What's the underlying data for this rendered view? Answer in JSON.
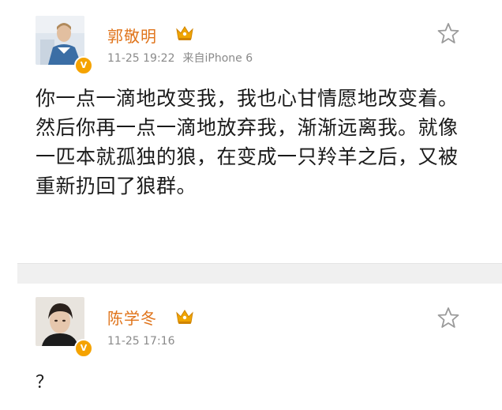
{
  "posts": [
    {
      "username": "郭敬明",
      "time": "11-25 19:22",
      "source": "来自iPhone 6",
      "content": "你一点一滴地改变我，我也心甘情愿地改变着。然后你再一点一滴地放弃我，渐渐远离我。就像一匹本就孤独的狼，在变成一只羚羊之后，又被重新扔回了狼群。",
      "verified_icon": "verified-badge-icon",
      "vip_icon": "vip-crown-icon",
      "favorite_icon": "star-icon"
    },
    {
      "username": "陈学冬",
      "time": "11-25 17:16",
      "content": "？",
      "verified_icon": "verified-badge-icon",
      "vip_icon": "vip-crown-icon",
      "favorite_icon": "star-icon"
    }
  ],
  "colors": {
    "username": "#e0741b",
    "meta": "#8a8a8a",
    "verified": "#f5a300",
    "crown": "#f0a500",
    "divider": "#f0f0f0"
  }
}
